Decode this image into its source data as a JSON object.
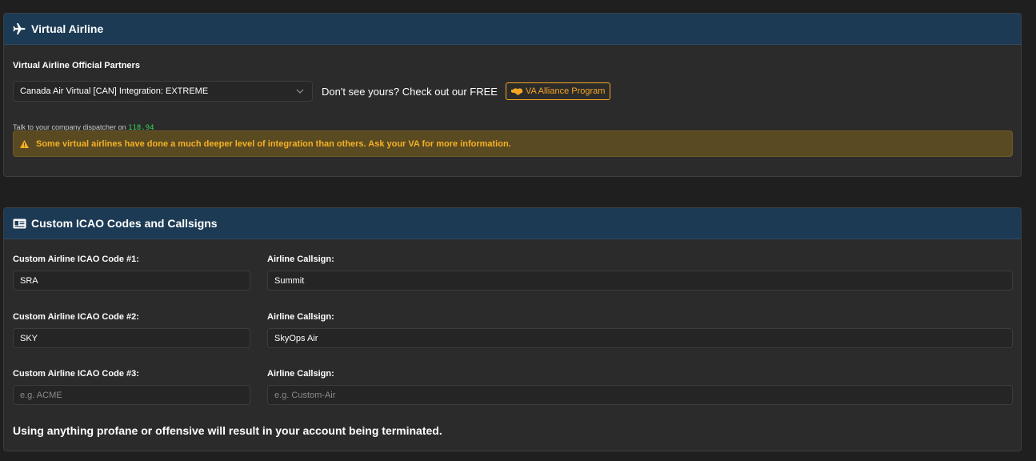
{
  "virtual_airline": {
    "header_title": "Virtual Airline",
    "partners_label": "Virtual Airline Official Partners",
    "selected_partner": "Canada Air Virtual [CAN] Integration: EXTREME",
    "dont_see_text": "Don't see yours? Check out our FREE",
    "alliance_button": "VA Alliance Program",
    "dispatcher_text": "Talk to your company dispatcher on",
    "dispatcher_freq": "118.94",
    "alert_text": "Some virtual airlines have done a much deeper level of integration than others. Ask your VA for more information."
  },
  "custom_icao": {
    "header_title": "Custom ICAO Codes and Callsigns",
    "rows": [
      {
        "icao_label": "Custom Airline ICAO Code #1:",
        "icao_value": "SRA",
        "icao_placeholder": "",
        "callsign_label": "Airline Callsign:",
        "callsign_value": "Summit",
        "callsign_placeholder": ""
      },
      {
        "icao_label": "Custom Airline ICAO Code #2:",
        "icao_value": "SKY",
        "icao_placeholder": "",
        "callsign_label": "Airline Callsign:",
        "callsign_value": "SkyOps Air",
        "callsign_placeholder": ""
      },
      {
        "icao_label": "Custom Airline ICAO Code #3:",
        "icao_value": "",
        "icao_placeholder": "e.g. ACME",
        "callsign_label": "Airline Callsign:",
        "callsign_value": "",
        "callsign_placeholder": "e.g. Custom-Air"
      }
    ],
    "warning_text": "Using anything profane or offensive will result in your account being terminated."
  },
  "colors": {
    "background": "#1f1f1f",
    "card": "#2b2b2b",
    "header": "#1c3a54",
    "accent_orange": "#f5a623",
    "alert_bg": "#5a4a22",
    "freq_green": "#3ad154"
  },
  "icons": [
    "plane-icon",
    "id-card-icon",
    "chevron-down-icon",
    "handshake-icon",
    "warning-icon"
  ]
}
